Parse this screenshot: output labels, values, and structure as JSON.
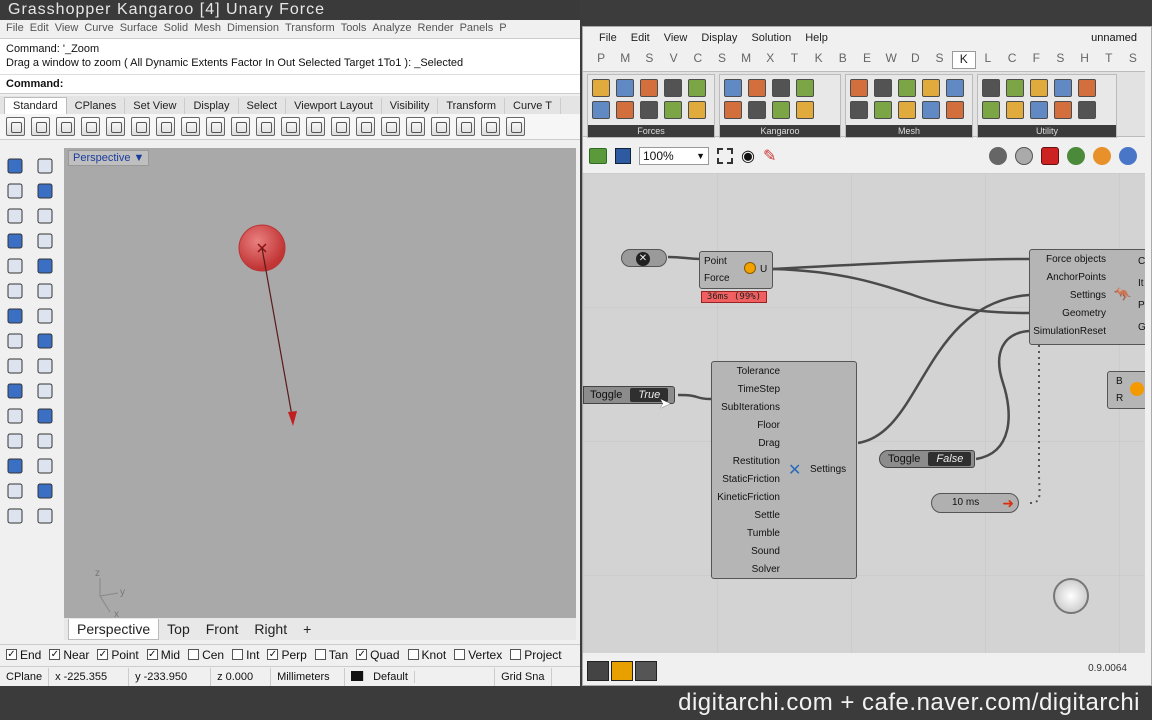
{
  "window_title": "Grasshopper  Kangaroo  [4]  Unary  Force",
  "rhino": {
    "menu": [
      "File",
      "Edit",
      "View",
      "Curve",
      "Surface",
      "Solid",
      "Mesh",
      "Dimension",
      "Transform",
      "Tools",
      "Analyze",
      "Render",
      "Panels",
      "P"
    ],
    "command_history": [
      "Command: '_Zoom",
      "Drag a window to zoom ( All  Dynamic  Extents  Factor  In  Out  Selected  Target  1To1 ): _Selected"
    ],
    "command_prompt": "Command:",
    "toolbar_tabs": [
      "Standard",
      "CPlanes",
      "Set View",
      "Display",
      "Select",
      "Viewport Layout",
      "Visibility",
      "Transform",
      "Curve T"
    ],
    "active_toolbar_tab": "Standard",
    "viewport_label": "Perspective",
    "viewport_tabs": [
      "Perspective",
      "Top",
      "Front",
      "Right",
      "+"
    ],
    "axis_labels": {
      "x": "x",
      "y": "y",
      "z": "z"
    },
    "osnaps": [
      {
        "label": "End",
        "checked": true
      },
      {
        "label": "Near",
        "checked": true
      },
      {
        "label": "Point",
        "checked": true
      },
      {
        "label": "Mid",
        "checked": true
      },
      {
        "label": "Cen",
        "checked": false
      },
      {
        "label": "Int",
        "checked": false
      },
      {
        "label": "Perp",
        "checked": true
      },
      {
        "label": "Tan",
        "checked": false
      },
      {
        "label": "Quad",
        "checked": true
      },
      {
        "label": "Knot",
        "checked": false
      },
      {
        "label": "Vertex",
        "checked": false
      },
      {
        "label": "Project",
        "checked": false
      }
    ],
    "status": {
      "cplane": "CPlane",
      "x": "x -225.355",
      "y": "y -233.950",
      "z": "z 0.000",
      "units": "Millimeters",
      "layer": "Default",
      "grid": "Grid Sna"
    }
  },
  "grasshopper": {
    "doc_name": "unnamed",
    "menu": [
      "File",
      "Edit",
      "View",
      "Display",
      "Solution",
      "Help"
    ],
    "tab_letters": [
      "P",
      "M",
      "S",
      "V",
      "C",
      "S",
      "M",
      "X",
      "T",
      "K",
      "B",
      "E",
      "W",
      "D",
      "S",
      "K",
      "L",
      "C",
      "F",
      "S",
      "H",
      "T",
      "S"
    ],
    "active_tab_letter": "K",
    "ribbon_groups": [
      "Forces",
      "Kangaroo",
      "Mesh",
      "Utility"
    ],
    "zoom": "100%",
    "components": {
      "unary": {
        "inputs": [
          "Point",
          "Force"
        ],
        "output": "U",
        "timing": "36ms (99%)"
      },
      "settings": {
        "inputs": [
          "Tolerance",
          "TimeStep",
          "SubIterations",
          "Floor",
          "Drag",
          "Restitution",
          "StaticFriction",
          "KineticFriction",
          "Settle",
          "Tumble",
          "Sound",
          "Solver"
        ],
        "output": "Settings"
      },
      "kangaroo": {
        "inputs": [
          "Force objects",
          "AnchorPoints",
          "Settings",
          "Geometry",
          "SimulationReset"
        ],
        "outputs": [
          "C",
          "It",
          "P",
          "G"
        ]
      },
      "small": {
        "inputs": [
          "B",
          "R"
        ]
      }
    },
    "toggle_true": {
      "label": "Toggle",
      "value": "True"
    },
    "toggle_false": {
      "label": "Toggle",
      "value": "False"
    },
    "timer": "10 ms",
    "version": "0.9.0064"
  },
  "watermark": "digitarchi.com  +  cafe.naver.com/digitarchi",
  "colors": {
    "chrome_dark": "#3b3b3b",
    "viewport": "#a9a9a9",
    "canvas": "#d3d3d3",
    "sphere": "#d44040",
    "timing_bg": "#f06060"
  }
}
